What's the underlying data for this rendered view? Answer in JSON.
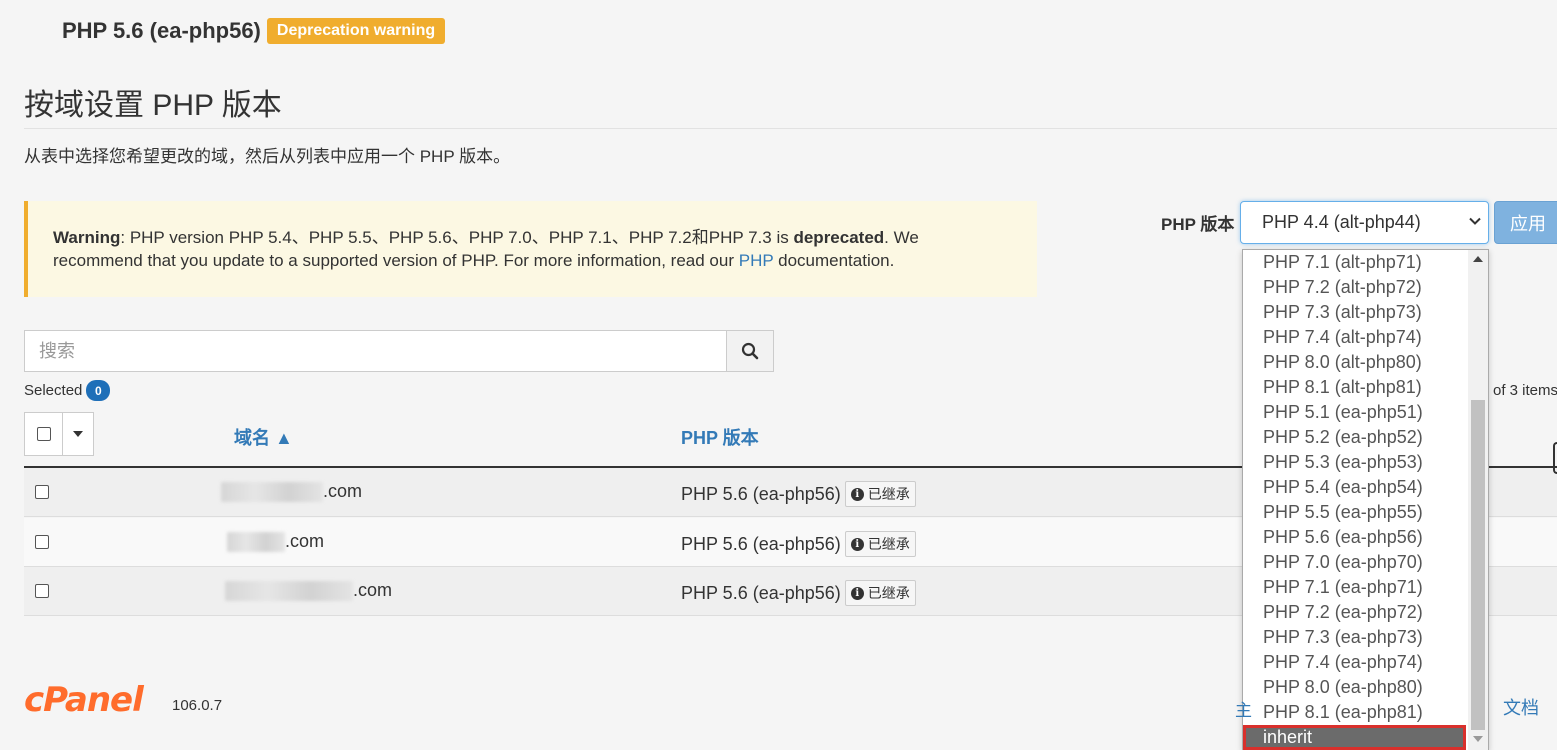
{
  "current_php": {
    "label": "PHP 5.6 (ea-php56)",
    "badge": "Deprecation warning"
  },
  "page": {
    "title": "按域设置 PHP 版本",
    "description": "从表中选择您希望更改的域，然后从列表中应用一个 PHP 版本。"
  },
  "alert": {
    "strong": "Warning",
    "text1": ": PHP version PHP 5.4、PHP 5.5、PHP 5.6、PHP 7.0、PHP 7.1、PHP 7.2和PHP 7.3 is ",
    "deprecated": "deprecated",
    "text2": ". We recommend that you update to a supported version of PHP. For more information, read our ",
    "link": "PHP",
    "text3": " documentation."
  },
  "search": {
    "placeholder": "搜索",
    "icon": "search-icon"
  },
  "selected": {
    "label": "Selected",
    "count": "0"
  },
  "table": {
    "columns": {
      "domain": "域名 ▲",
      "php_version": "PHP 版本"
    },
    "rows": [
      {
        "domain_suffix": ".com",
        "php": "PHP 5.6 (ea-php56)",
        "badge": "已继承"
      },
      {
        "domain_suffix": ".com",
        "php": "PHP 5.6 (ea-php56)",
        "badge": "已继承"
      },
      {
        "domain_suffix": ".com",
        "php": "PHP 5.6 (ea-php56)",
        "badge": "已继承"
      }
    ]
  },
  "pager": {
    "text": "of 3 items"
  },
  "php_selector": {
    "label": "PHP 版本",
    "selected": "PHP 4.4 (alt-php44)",
    "apply": "应用",
    "options": [
      "PHP 7.1 (alt-php71)",
      "PHP 7.2 (alt-php72)",
      "PHP 7.3 (alt-php73)",
      "PHP 7.4 (alt-php74)",
      "PHP 8.0 (alt-php80)",
      "PHP 8.1 (alt-php81)",
      "PHP 5.1 (ea-php51)",
      "PHP 5.2 (ea-php52)",
      "PHP 5.3 (ea-php53)",
      "PHP 5.4 (ea-php54)",
      "PHP 5.5 (ea-php55)",
      "PHP 5.6 (ea-php56)",
      "PHP 7.0 (ea-php70)",
      "PHP 7.1 (ea-php71)",
      "PHP 7.2 (ea-php72)",
      "PHP 7.3 (ea-php73)",
      "PHP 7.4 (ea-php74)",
      "PHP 8.0 (ea-php80)",
      "PHP 8.1 (ea-php81)",
      "inherit"
    ],
    "highlighted_option": "inherit"
  },
  "footer": {
    "logo": "cPanel",
    "version": "106.0.7",
    "partial_link": "主",
    "docs": "文档"
  },
  "colors": {
    "warning_badge": "#f0ad2e",
    "link": "#337ab7",
    "cpanel_orange": "#ff6c2c",
    "highlight_border": "#d9302c"
  }
}
